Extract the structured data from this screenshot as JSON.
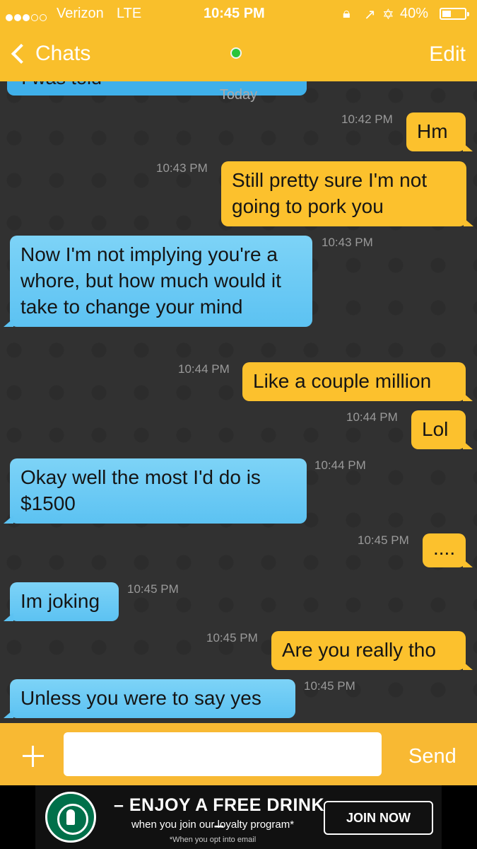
{
  "status_bar": {
    "carrier": "Verizon",
    "network": "LTE",
    "time": "10:45 PM",
    "battery": "40%",
    "signal_bars": 3,
    "icons": [
      "lock-rotation-icon",
      "location-arrow-icon",
      "bluetooth-icon"
    ]
  },
  "nav": {
    "back_label": "Chats",
    "edit_label": "Edit",
    "online_color": "#2ac53a"
  },
  "chat": {
    "previous_message_partial": "I was told",
    "date_divider": "Today",
    "messages": [
      {
        "dir": "out",
        "time": "10:42 PM",
        "text": "Hm"
      },
      {
        "dir": "out",
        "time": "10:43 PM",
        "text": "Still pretty sure I'm not going to pork you"
      },
      {
        "dir": "in",
        "time": "10:43 PM",
        "text": "Now I'm not implying you're a whore, but how much would it take to change your mind"
      },
      {
        "dir": "out",
        "time": "10:44 PM",
        "text": "Like a couple million"
      },
      {
        "dir": "out",
        "time": "10:44 PM",
        "text": "Lol"
      },
      {
        "dir": "in",
        "time": "10:44 PM",
        "text": "Okay well the most I'd do is $1500"
      },
      {
        "dir": "out",
        "time": "10:45 PM",
        "text": "...."
      },
      {
        "dir": "in",
        "time": "10:45 PM",
        "text": "Im joking"
      },
      {
        "dir": "out",
        "time": "10:45 PM",
        "text": "Are you really tho"
      },
      {
        "dir": "in",
        "time": "10:45 PM",
        "text": "Unless you were to say yes"
      }
    ],
    "colors": {
      "outgoing": "#fcc12d",
      "incoming": "#5cc2f2",
      "background": "#313131"
    }
  },
  "compose": {
    "input_value": "",
    "send_label": "Send"
  },
  "ad": {
    "title": "– ENJOY A FREE DRINK –",
    "subtitle": "when you join our loyalty program*",
    "fine_print": "*When you opt into email",
    "cta": "JOIN NOW",
    "logo": "starbucks-logo"
  },
  "header_color": "#f9bf2b"
}
